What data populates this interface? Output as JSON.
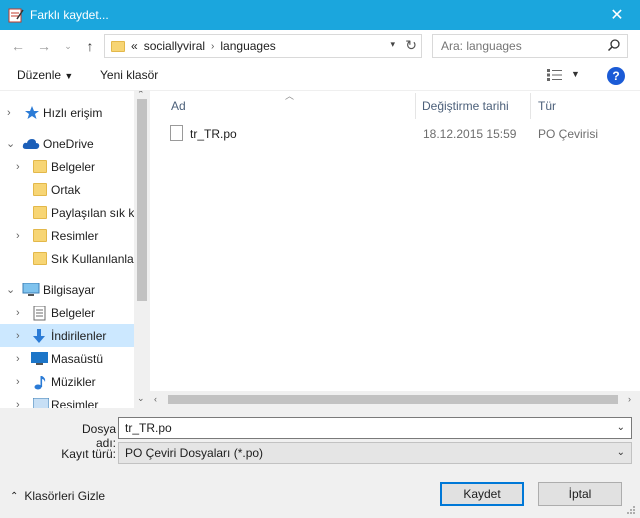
{
  "window": {
    "title": "Farklı kaydet..."
  },
  "address": {
    "overflow": "«",
    "crumbs": [
      "sociallyviral",
      "languages"
    ]
  },
  "search": {
    "placeholder": "Ara: languages"
  },
  "toolbar": {
    "organize": "Düzenle",
    "new_folder": "Yeni klasör"
  },
  "nav": {
    "items": [
      {
        "label": "Hızlı erişim",
        "icon": "star-icon"
      },
      {
        "label": "OneDrive",
        "icon": "cloud-icon"
      },
      {
        "label": "Belgeler",
        "icon": "folder-icon"
      },
      {
        "label": "Ortak",
        "icon": "folder-icon"
      },
      {
        "label": "Paylaşılan sık ku",
        "icon": "folder-icon"
      },
      {
        "label": "Resimler",
        "icon": "folder-icon"
      },
      {
        "label": "Sık Kullanılanlar",
        "icon": "folder-icon"
      },
      {
        "label": "Bilgisayar",
        "icon": "computer-icon"
      },
      {
        "label": "Belgeler",
        "icon": "documents-icon"
      },
      {
        "label": "İndirilenler",
        "icon": "download-icon"
      },
      {
        "label": "Masaüstü",
        "icon": "desktop-icon"
      },
      {
        "label": "Müzikler",
        "icon": "music-icon"
      },
      {
        "label": "Resimler",
        "icon": "pictures-icon"
      }
    ]
  },
  "filelist": {
    "columns": {
      "name": "Ad",
      "date": "Değiştirme tarihi",
      "type": "Tür"
    },
    "rows": [
      {
        "name": "tr_TR.po",
        "date": "18.12.2015 15:59",
        "type": "PO Çevirisi"
      }
    ]
  },
  "form": {
    "filename_label": "Dosya adı:",
    "filename_value": "tr_TR.po",
    "filetype_label": "Kayıt türü:",
    "filetype_value": "PO Çeviri Dosyaları (*.po)"
  },
  "footer": {
    "hide_folders": "Klasörleri Gizle",
    "save": "Kaydet",
    "cancel": "İptal"
  },
  "colors": {
    "titlebar": "#1ba6dd",
    "selection": "#cce8ff",
    "accent": "#0078d7"
  }
}
